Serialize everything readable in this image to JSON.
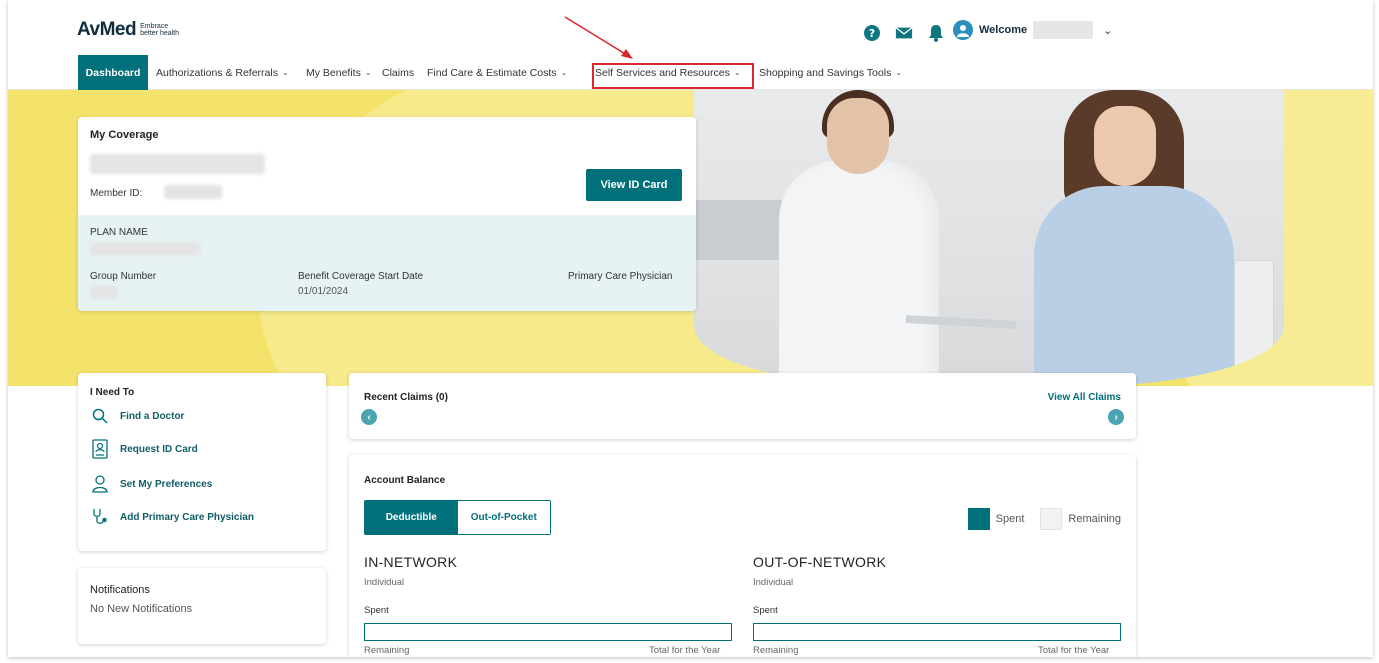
{
  "header": {
    "logo": "AvMed",
    "tagline_line1": "Embrace",
    "tagline_line2": "better health",
    "welcome": "Welcome"
  },
  "nav": {
    "dashboard": "Dashboard",
    "items": [
      "Authorizations & Referrals",
      "My Benefits",
      "Claims",
      "Find Care & Estimate Costs",
      "Self Services and Resources",
      "Shopping and Savings Tools"
    ]
  },
  "coverage": {
    "title": "My Coverage",
    "member_id_label": "Member ID:",
    "view_id_button": "View ID Card",
    "plan_name_label": "PLAN NAME",
    "group_number_label": "Group Number",
    "benefit_start_label": "Benefit Coverage Start Date",
    "benefit_start_value": "01/01/2024",
    "pcp_label": "Primary Care Physician"
  },
  "i_need_to": {
    "title": "I Need To",
    "actions": [
      "Find a Doctor",
      "Request ID Card",
      "Set My Preferences",
      "Add Primary Care Physician"
    ]
  },
  "notifications": {
    "title": "Notifications",
    "text": "No New Notifications"
  },
  "recent_claims": {
    "title": "Recent Claims (0)",
    "view_all": "View All Claims"
  },
  "account_balance": {
    "title": "Account Balance",
    "tabs": [
      "Deductible",
      "Out-of-Pocket"
    ],
    "active_tab": "Deductible",
    "legend_spent": "Spent",
    "legend_remaining": "Remaining",
    "in_network": {
      "title": "IN-NETWORK",
      "subtitle": "Individual",
      "spent_label": "Spent",
      "spent_fraction": 0,
      "remaining_label": "Remaining",
      "total_label": "Total for the Year"
    },
    "out_network": {
      "title": "OUT-OF-NETWORK",
      "subtitle": "Individual",
      "spent_label": "Spent",
      "spent_fraction": 0,
      "remaining_label": "Remaining",
      "total_label": "Total for the Year"
    }
  },
  "colors": {
    "primary_teal": "#00707a",
    "highlight_red": "#e0262d",
    "hero_yellow": "#f3e36b"
  }
}
